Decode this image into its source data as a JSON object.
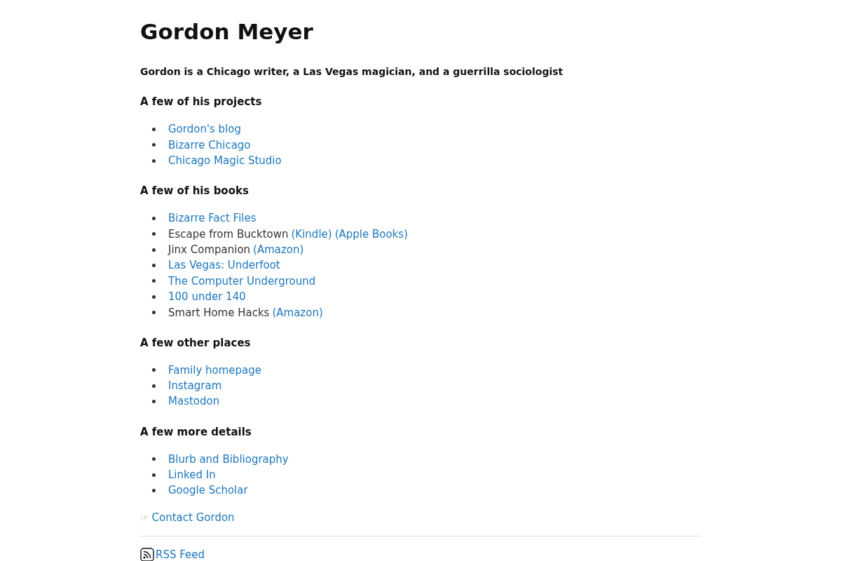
{
  "title": "Gordon Meyer",
  "tagline": "Gordon is a Chicago writer, a Las Vegas magician, and a guerrilla sociologist",
  "sections": [
    {
      "heading": "A few of his projects",
      "items": [
        {
          "parts": [
            {
              "kind": "link",
              "text": "Gordon's blog"
            }
          ]
        },
        {
          "parts": [
            {
              "kind": "link",
              "text": "Bizarre Chicago"
            }
          ]
        },
        {
          "parts": [
            {
              "kind": "link",
              "text": "Chicago Magic Studio"
            }
          ]
        }
      ]
    },
    {
      "heading": "A few of his books",
      "items": [
        {
          "parts": [
            {
              "kind": "link",
              "text": "Bizarre Fact Files"
            }
          ]
        },
        {
          "parts": [
            {
              "kind": "text",
              "text": "Escape from Bucktown"
            },
            {
              "kind": "link",
              "text": "(Kindle)"
            },
            {
              "kind": "link",
              "text": "(Apple Books)"
            }
          ]
        },
        {
          "parts": [
            {
              "kind": "text",
              "text": "Jinx Companion"
            },
            {
              "kind": "link",
              "text": "(Amazon)"
            }
          ]
        },
        {
          "parts": [
            {
              "kind": "link",
              "text": "Las Vegas: Underfoot"
            }
          ]
        },
        {
          "parts": [
            {
              "kind": "link",
              "text": "The Computer Underground"
            }
          ]
        },
        {
          "parts": [
            {
              "kind": "link",
              "text": "100 under 140"
            }
          ]
        },
        {
          "parts": [
            {
              "kind": "text",
              "text": "Smart Home Hacks"
            },
            {
              "kind": "link",
              "text": "(Amazon)"
            }
          ]
        }
      ]
    },
    {
      "heading": "A few other places",
      "items": [
        {
          "parts": [
            {
              "kind": "link",
              "text": "Family homepage"
            }
          ]
        },
        {
          "parts": [
            {
              "kind": "link",
              "text": "Instagram"
            }
          ]
        },
        {
          "parts": [
            {
              "kind": "link",
              "text": "Mastodon"
            }
          ]
        }
      ]
    },
    {
      "heading": "A few more details",
      "items": [
        {
          "parts": [
            {
              "kind": "link",
              "text": "Blurb and Bibliography"
            }
          ]
        },
        {
          "parts": [
            {
              "kind": "link",
              "text": "Linked In"
            }
          ]
        },
        {
          "parts": [
            {
              "kind": "link",
              "text": "Google Scholar"
            }
          ]
        }
      ]
    }
  ],
  "contact": {
    "icon": "☞",
    "link": "Contact Gordon"
  },
  "footer": {
    "rss_link": "RSS Feed"
  }
}
